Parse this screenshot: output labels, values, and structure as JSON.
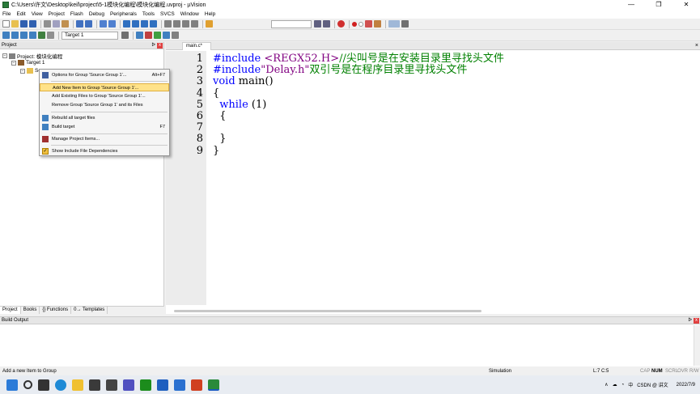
{
  "window": {
    "title": "C:\\Users\\许文\\Desktop\\keil\\project\\5-1模块化编程\\模块化编程.uvproj - µVision",
    "minimize": "—",
    "maximize": "❐",
    "close": "✕"
  },
  "menubar": [
    "File",
    "Edit",
    "View",
    "Project",
    "Flash",
    "Debug",
    "Peripherals",
    "Tools",
    "SVCS",
    "Window",
    "Help"
  ],
  "toolbar": {
    "target": "Target 1"
  },
  "project_panel": {
    "title": "Project",
    "pin": "📌",
    "close": "x",
    "tree": {
      "root": "Project: 模块化编程",
      "target": "Target 1",
      "group_partial": "So"
    },
    "tabs": [
      "Project",
      "Books",
      "{} Functions",
      "0→ Templates"
    ]
  },
  "editor": {
    "tab": "main.c*",
    "close": "×",
    "lines": [
      {
        "n": "1",
        "parts": [
          {
            "t": "#include ",
            "c": "inc"
          },
          {
            "t": "<REGX52.H>",
            "c": "str"
          },
          {
            "t": "//尖叫号是在安装目录里寻找头文件",
            "c": "cmt"
          }
        ]
      },
      {
        "n": "2",
        "parts": [
          {
            "t": "#include",
            "c": "inc"
          },
          {
            "t": "\"Delay.h\"",
            "c": "str"
          },
          {
            "t": "双引号是在程序目录里寻找头文件",
            "c": "cmt"
          }
        ]
      },
      {
        "n": "3",
        "parts": [
          {
            "t": "void",
            "c": "kw"
          },
          {
            "t": " main()",
            "c": ""
          }
        ]
      },
      {
        "n": "4",
        "parts": [
          {
            "t": "{",
            "c": ""
          }
        ]
      },
      {
        "n": "5",
        "parts": [
          {
            "t": "  ",
            "c": ""
          },
          {
            "t": "while",
            "c": "kw"
          },
          {
            "t": " (1)",
            "c": ""
          }
        ]
      },
      {
        "n": "6",
        "parts": [
          {
            "t": "  {",
            "c": ""
          }
        ]
      },
      {
        "n": "7",
        "parts": [
          {
            "t": "",
            "c": ""
          }
        ]
      },
      {
        "n": "8",
        "parts": [
          {
            "t": "  }",
            "c": ""
          }
        ]
      },
      {
        "n": "9",
        "parts": [
          {
            "t": "}",
            "c": ""
          }
        ]
      }
    ]
  },
  "context_menu": {
    "items": [
      {
        "label": "Options for Group 'Source Group 1'...",
        "shortcut": "Alt+F7",
        "icon": "options-icon",
        "highlight": false
      },
      {
        "label": "Add New  Item to Group 'Source Group 1'...",
        "shortcut": "",
        "icon": "",
        "highlight": true
      },
      {
        "label": "Add Existing Files to Group 'Source Group 1'...",
        "shortcut": "",
        "icon": "",
        "highlight": false
      },
      {
        "label": "Remove Group 'Source Group 1' and its Files",
        "shortcut": "",
        "icon": "",
        "highlight": false
      },
      {
        "label": "Rebuild all target files",
        "shortcut": "",
        "icon": "rebuild-icon",
        "highlight": false
      },
      {
        "label": "Build target",
        "shortcut": "F7",
        "icon": "build-icon",
        "highlight": false
      },
      {
        "label": "Manage Project Items...",
        "shortcut": "",
        "icon": "manage-icon",
        "highlight": false
      },
      {
        "label": "Show Include File Dependencies",
        "shortcut": "",
        "icon": "check-icon",
        "highlight": false
      }
    ]
  },
  "build_output": {
    "title": "Build Output"
  },
  "statusbar": {
    "message": "Add a new Item to Group",
    "mode": "Simulation",
    "position": "L:7 C:5",
    "caps": "CAP",
    "num": "NUM",
    "scrl": "SCRL",
    "ovr": "OVR",
    "rw": "R/W"
  },
  "taskbar": {
    "tray_ime": "中",
    "tray_text": "CSDN @ 讲文",
    "date": "2022/7/9"
  }
}
